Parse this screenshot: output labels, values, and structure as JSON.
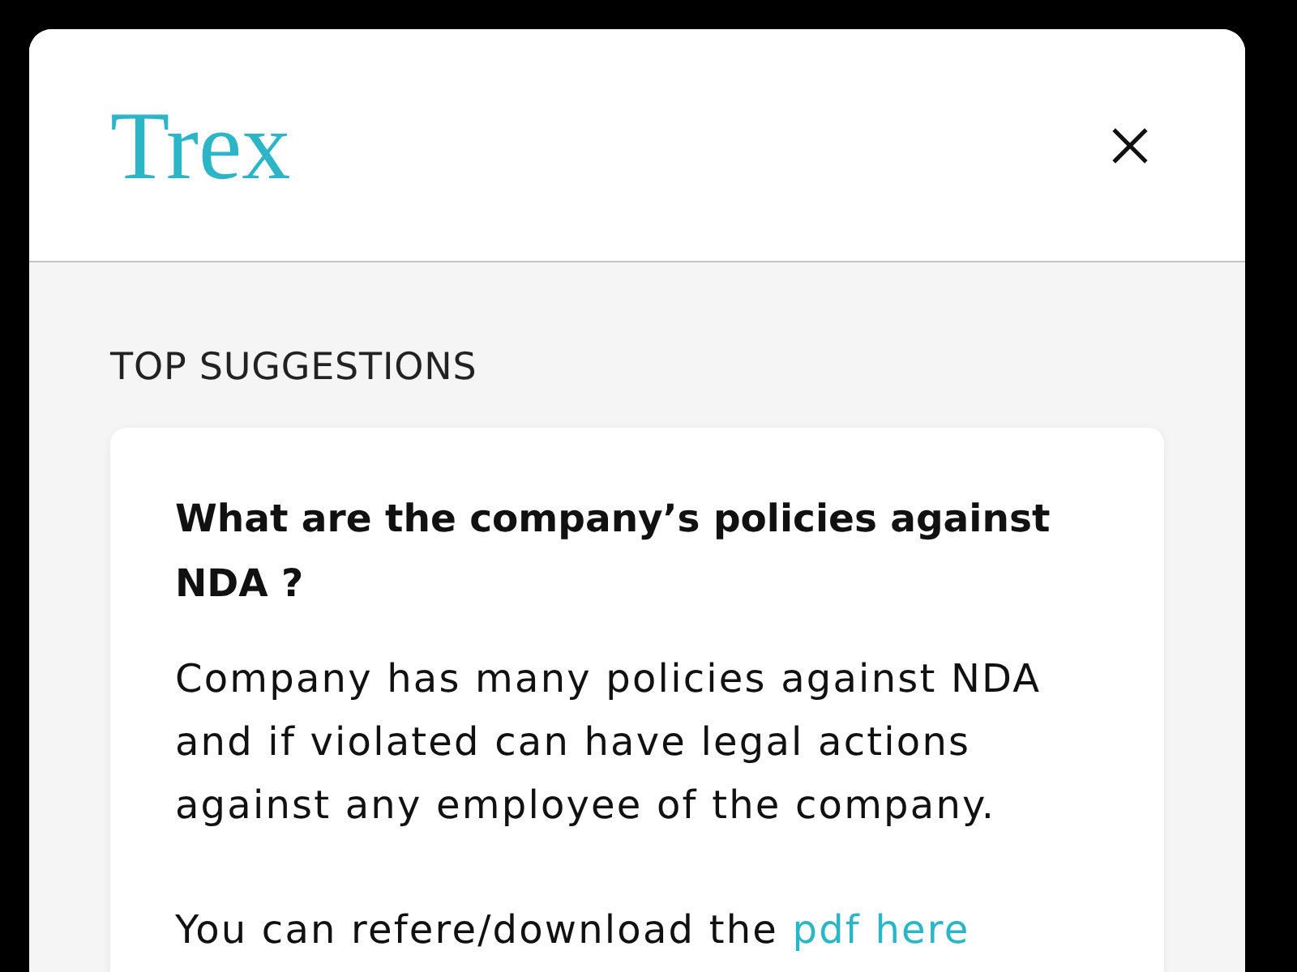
{
  "header": {
    "logo": "Trex"
  },
  "section_title": "TOP SUGGESTIONS",
  "suggestions": [
    {
      "question": "What are the company’s policies against NDA ?",
      "answer": "Company has many policies against NDA and if violated can have legal actions against any employee of the company.",
      "note": "You can refere/download the",
      "link": "pdf here"
    }
  ]
}
